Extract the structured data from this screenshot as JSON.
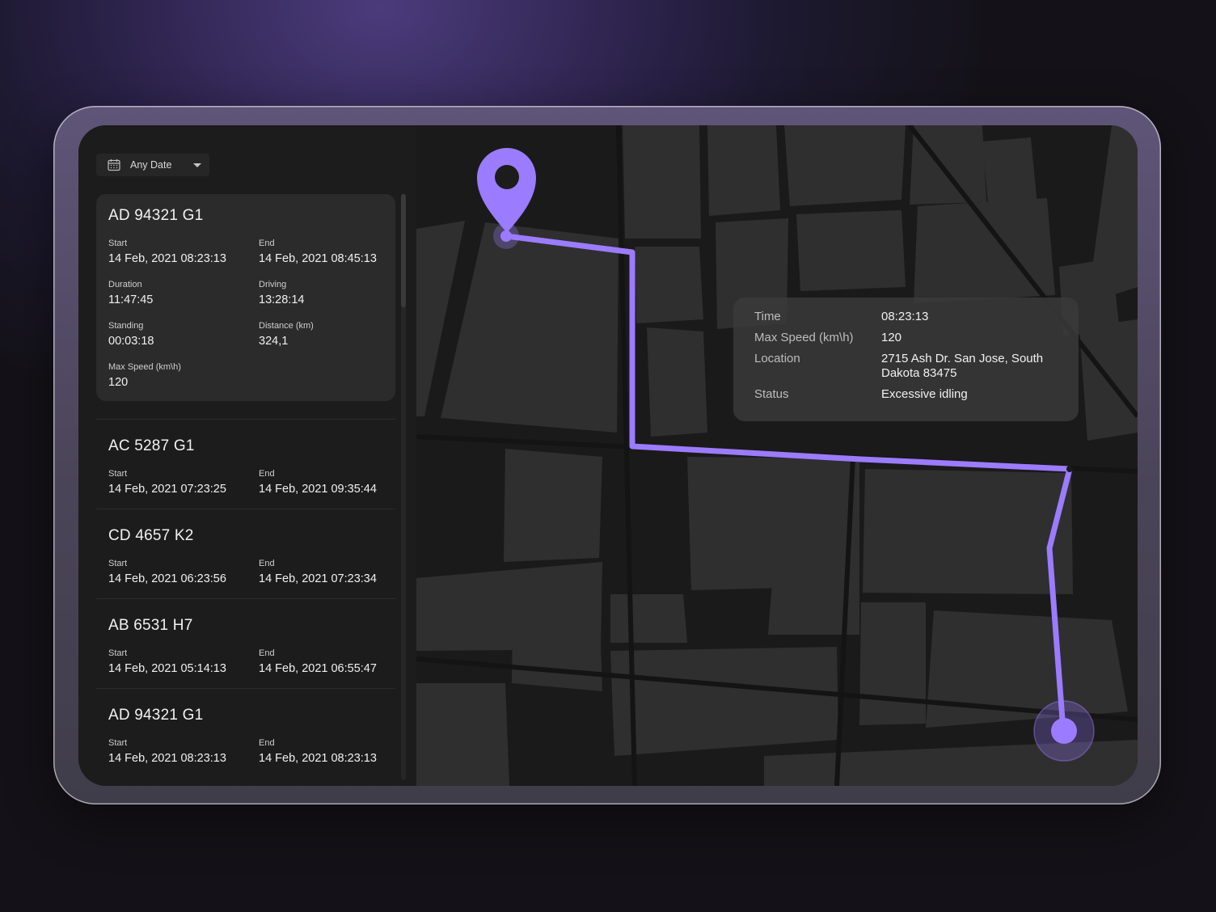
{
  "filter": {
    "date_label": "Any Date"
  },
  "trips": [
    {
      "plate": "AD 94321 G1",
      "fields": [
        {
          "label": "Start",
          "value": "14 Feb, 2021 08:23:13"
        },
        {
          "label": "End",
          "value": "14 Feb, 2021 08:45:13"
        },
        {
          "label": "Duration",
          "value": "11:47:45"
        },
        {
          "label": "Driving",
          "value": "13:28:14"
        },
        {
          "label": "Standing",
          "value": "00:03:18"
        },
        {
          "label": "Distance (km)",
          "value": "324,1"
        },
        {
          "label": "Max Speed (km\\h)",
          "value": "120"
        }
      ]
    },
    {
      "plate": "AC 5287 G1",
      "fields": [
        {
          "label": "Start",
          "value": "14 Feb, 2021 07:23:25"
        },
        {
          "label": "End",
          "value": "14 Feb, 2021 09:35:44"
        }
      ]
    },
    {
      "plate": "CD 4657 K2",
      "fields": [
        {
          "label": "Start",
          "value": "14 Feb, 2021 06:23:56"
        },
        {
          "label": "End",
          "value": "14 Feb, 2021 07:23:34"
        }
      ]
    },
    {
      "plate": "AB 6531 H7",
      "fields": [
        {
          "label": "Start",
          "value": "14 Feb, 2021 05:14:13"
        },
        {
          "label": "End",
          "value": "14 Feb, 2021 06:55:47"
        }
      ]
    },
    {
      "plate": "AD 94321 G1",
      "fields": [
        {
          "label": "Start",
          "value": "14 Feb, 2021 08:23:13"
        },
        {
          "label": "End",
          "value": "14 Feb, 2021 08:23:13"
        }
      ]
    }
  ],
  "info": [
    {
      "label": "Time",
      "value": "08:23:13"
    },
    {
      "label": "Max Speed (km\\h)",
      "value": "120"
    },
    {
      "label": "Location",
      "value": "2715 Ash Dr. San Jose, South Dakota 83475"
    },
    {
      "label": "Status",
      "value": "Excessive idling"
    }
  ],
  "colors": {
    "accent": "#9b7bff",
    "panel": "#2b2b2b",
    "map_block": "#2f2f2f"
  },
  "icons": {
    "date": "calendar-icon",
    "dropdown": "chevron-down-icon",
    "start": "map-pin-icon",
    "end": "destination-marker-icon"
  }
}
